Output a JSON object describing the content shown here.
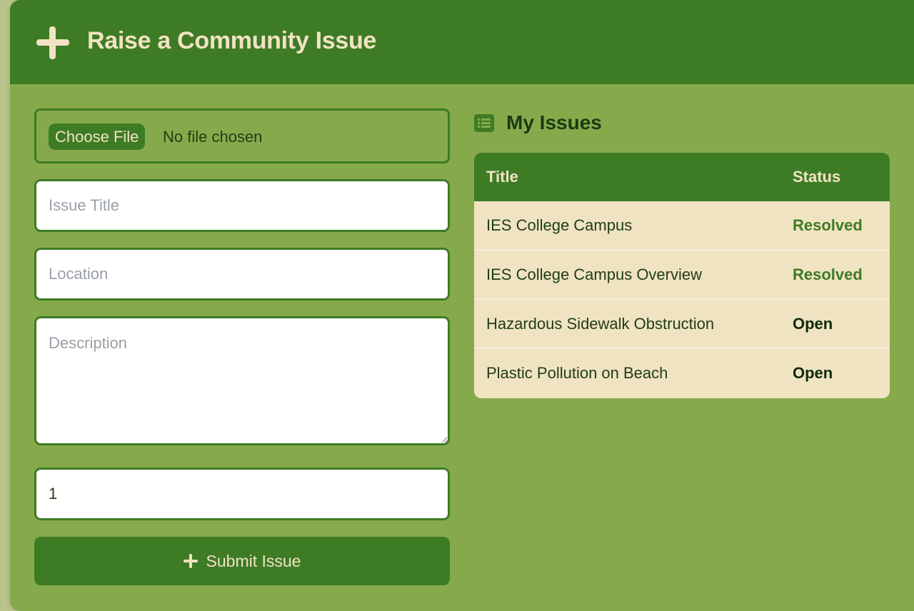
{
  "header": {
    "title": "Raise a Community Issue",
    "icon": "plus-icon"
  },
  "form": {
    "file": {
      "button_label": "Choose File",
      "status_text": "No file chosen"
    },
    "title_field": {
      "placeholder": "Issue Title",
      "value": ""
    },
    "location_field": {
      "placeholder": "Location",
      "value": ""
    },
    "description_field": {
      "placeholder": "Description",
      "value": ""
    },
    "number_field": {
      "value": "1"
    },
    "submit_label": "Submit Issue"
  },
  "issues": {
    "heading": "My Issues",
    "icon": "list-icon",
    "columns": [
      "Title",
      "Status"
    ],
    "rows": [
      {
        "title": "IES College Campus",
        "status": "Resolved"
      },
      {
        "title": "IES College Campus Overview",
        "status": "Resolved"
      },
      {
        "title": "Hazardous Sidewalk Obstruction",
        "status": "Open"
      },
      {
        "title": "Plastic Pollution on Beach",
        "status": "Open"
      }
    ]
  },
  "colors": {
    "primary": "#3e7b25",
    "panel": "#86aa4b",
    "cream": "#f1e3c3",
    "resolved": "#3e7b25",
    "open": "#0f2a0c"
  }
}
